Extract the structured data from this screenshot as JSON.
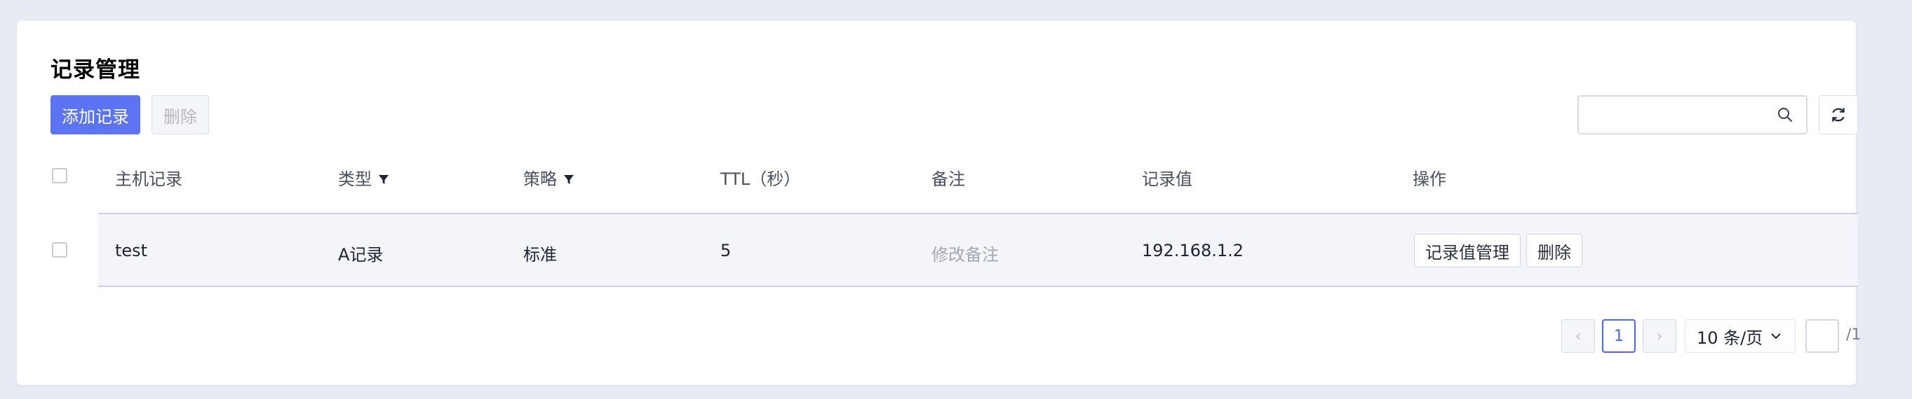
{
  "page": {
    "title": "记录管理"
  },
  "toolbar": {
    "add_label": "添加记录",
    "delete_label": "删除",
    "search_placeholder": "",
    "search_icon": "search-icon",
    "refresh_icon": "refresh-icon"
  },
  "table": {
    "columns": [
      "主机记录",
      "类型",
      "策略",
      "TTL（秒）",
      "备注",
      "记录值",
      "操作"
    ],
    "filterable_columns": [
      "类型",
      "策略"
    ],
    "rows": [
      {
        "host": "test",
        "type": "A记录",
        "strategy": "标准",
        "ttl": "5",
        "remark": "修改备注",
        "value": "192.168.1.2",
        "actions": [
          "记录值管理",
          "删除"
        ]
      }
    ]
  },
  "pagination": {
    "prev": "‹",
    "current_page": "1",
    "next": "›",
    "page_size": "10 条/页",
    "jump_value": "",
    "total_pages": "/1"
  },
  "colors": {
    "primary": "#5b74f2",
    "background": "#e8eaf4",
    "row_highlight": "#f4f5fa"
  }
}
